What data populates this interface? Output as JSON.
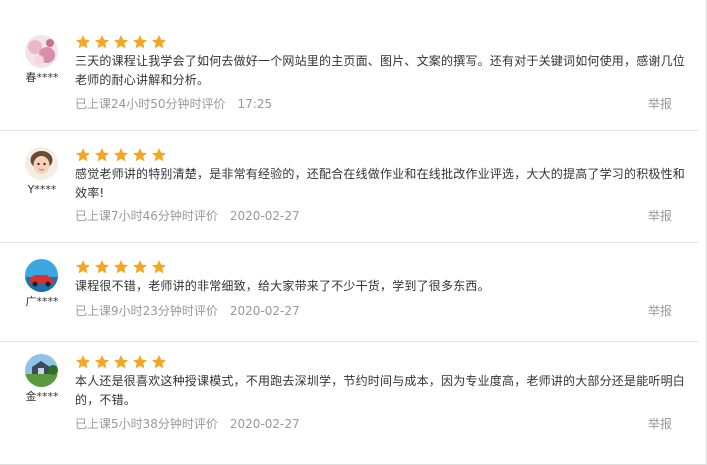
{
  "report_label": "举报",
  "star_color": "#f5a623",
  "reviews": [
    {
      "user": "春****",
      "rating": 5,
      "text": "三天的课程让我学会了如何去做好一个网站里的主页面、图片、文案的撰写。还有对于关键词如何使用，感谢几位老师的耐心讲解和分析。",
      "meta": "已上课24小时50分钟时评价",
      "date": "17:25"
    },
    {
      "user": "Y****",
      "rating": 5,
      "text": "感觉老师讲的特别清楚，是非常有经验的，还配合在线做作业和在线批改作业评选，大大的提高了学习的积极性和效率!",
      "meta": "已上课7小时46分钟时评价",
      "date": "2020-02-27"
    },
    {
      "user": "广****",
      "rating": 5,
      "text": "课程很不错，老师讲的非常细致，给大家带来了不少干货，学到了很多东西。",
      "meta": "已上课9小时23分钟时评价",
      "date": "2020-02-27"
    },
    {
      "user": "金****",
      "rating": 5,
      "text": "本人还是很喜欢这种授课模式，不用跑去深圳学，节约时间与成本，因为专业度高，老师讲的大部分还是能听明白的，不错。",
      "meta": "已上课5小时38分钟时评价",
      "date": "2020-02-27"
    }
  ]
}
